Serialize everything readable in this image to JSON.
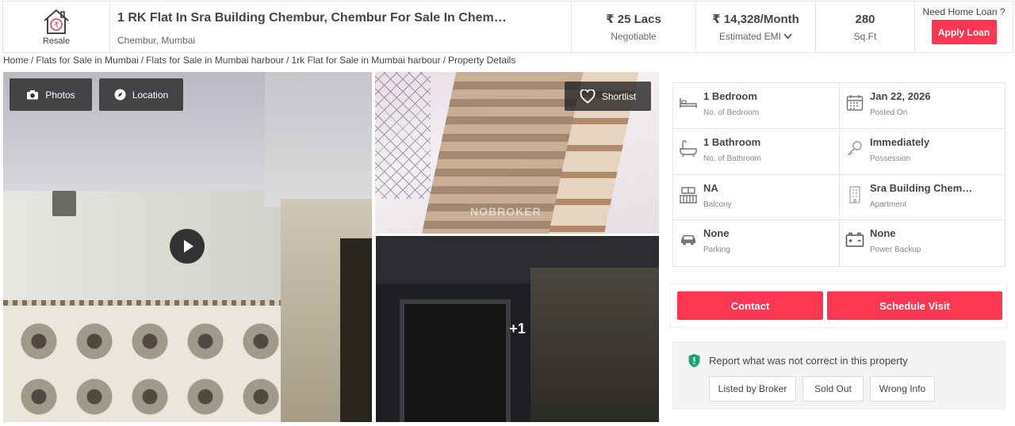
{
  "header": {
    "resale_label": "Resale",
    "title": "1 RK Flat In Sra Building Chembur, Chembur For Sale In Chem…",
    "location": "Chembur, Mumbai",
    "price": {
      "value": "₹ 25 Lacs",
      "sub": "Negotiable"
    },
    "emi": {
      "value": "₹ 14,328/Month",
      "sub": "Estimated EMI"
    },
    "area": {
      "value": "280",
      "sub": "Sq.Ft"
    },
    "loan_question": "Need Home Loan ?",
    "apply_loan_label": "Apply Loan"
  },
  "breadcrumb": [
    "Home",
    "Flats for Sale in Mumbai",
    "Flats for Sale in Mumbai harbour",
    "1rk Flat for Sale in Mumbai harbour",
    "Property Details"
  ],
  "gallery": {
    "photos_label": "Photos",
    "location_label": "Location",
    "shortlist_label": "Shortlist",
    "more_count": "+1",
    "watermark": "NOBROKER"
  },
  "details": [
    {
      "icon": "bed-icon",
      "value": "1 Bedroom",
      "label": "No. of Bedroom"
    },
    {
      "icon": "calendar-icon",
      "value": "Jan 22, 2026",
      "label": "Posted On"
    },
    {
      "icon": "bathtub-icon",
      "value": "1 Bathroom",
      "label": "No. of Bathroom"
    },
    {
      "icon": "key-icon",
      "value": "Immediately",
      "label": "Possession"
    },
    {
      "icon": "balcony-icon",
      "value": "NA",
      "label": "Balcony"
    },
    {
      "icon": "building-icon",
      "value": "Sra Building Chem…",
      "label": "Apartment"
    },
    {
      "icon": "car-icon",
      "value": "None",
      "label": "Parking"
    },
    {
      "icon": "battery-icon",
      "value": "None",
      "label": "Power Backup"
    }
  ],
  "actions": {
    "contact_label": "Contact",
    "schedule_label": "Schedule Visit"
  },
  "report": {
    "text": "Report what was not correct in this property",
    "options": [
      "Listed by Broker",
      "Sold Out",
      "Wrong Info"
    ]
  },
  "colors": {
    "accent": "#fd3752",
    "report_icon": "#1aa577",
    "text": "#464646"
  }
}
